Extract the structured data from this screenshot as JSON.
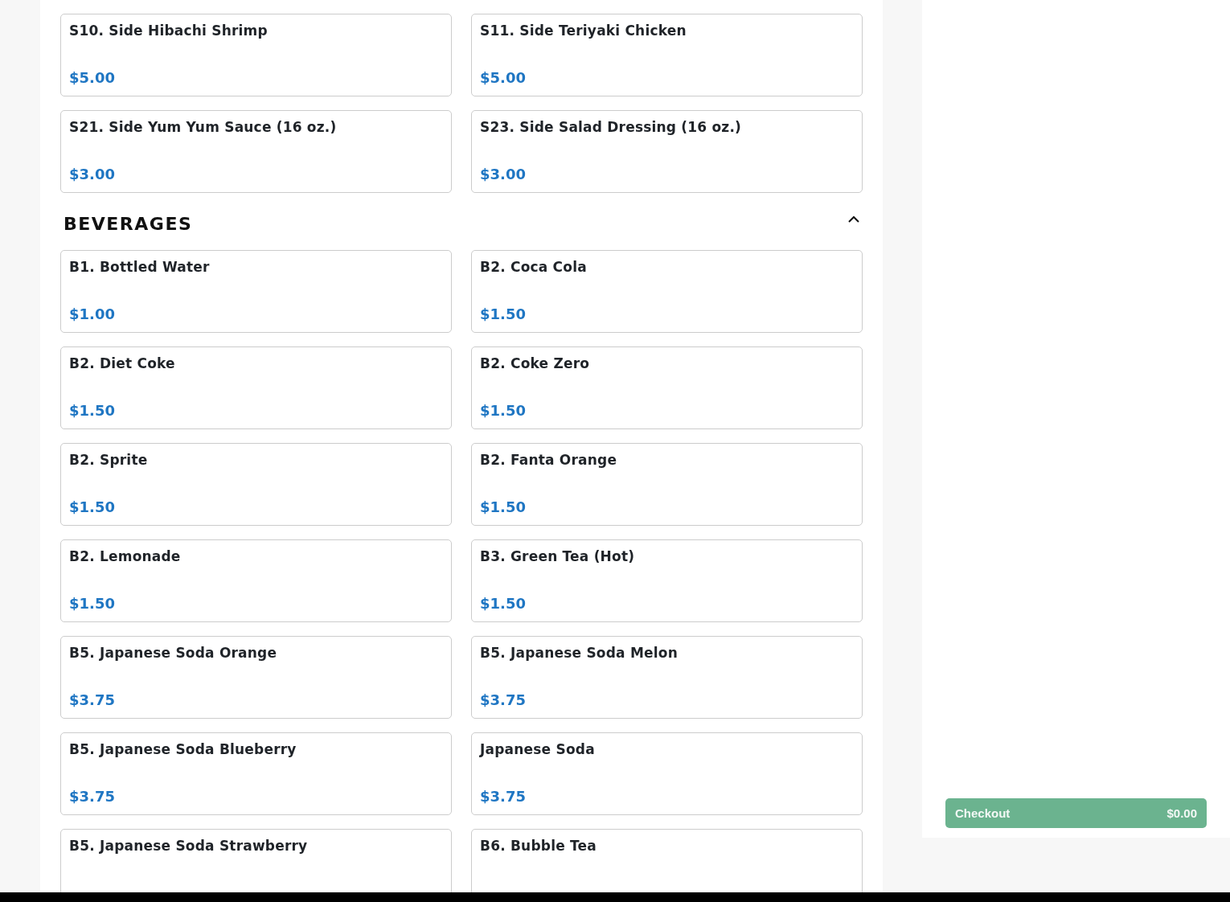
{
  "sections": [
    {
      "items": [
        {
          "name": "S10. Side Hibachi Shrimp",
          "price": "$5.00"
        },
        {
          "name": "S11. Side Teriyaki Chicken",
          "price": "$5.00"
        },
        {
          "name": "S21. Side Yum Yum Sauce (16 oz.)",
          "price": "$3.00"
        },
        {
          "name": "S23. Side Salad Dressing (16 oz.)",
          "price": "$3.00"
        }
      ]
    },
    {
      "title": "BEVERAGES",
      "expanded": true,
      "items": [
        {
          "name": "B1. Bottled Water",
          "price": "$1.00"
        },
        {
          "name": "B2. Coca Cola",
          "price": "$1.50"
        },
        {
          "name": "B2. Diet Coke",
          "price": "$1.50"
        },
        {
          "name": "B2. Coke Zero",
          "price": "$1.50"
        },
        {
          "name": "B2. Sprite",
          "price": "$1.50"
        },
        {
          "name": "B2. Fanta Orange",
          "price": "$1.50"
        },
        {
          "name": "B2. Lemonade",
          "price": "$1.50"
        },
        {
          "name": "B3. Green Tea (Hot)",
          "price": "$1.50"
        },
        {
          "name": "B5. Japanese Soda Orange",
          "price": "$3.75"
        },
        {
          "name": "B5. Japanese Soda Melon",
          "price": "$3.75"
        },
        {
          "name": "B5. Japanese Soda Blueberry",
          "price": "$3.75"
        },
        {
          "name": "Japanese Soda",
          "price": "$3.75"
        },
        {
          "name": "B5. Japanese Soda Strawberry"
        },
        {
          "name": "B6. Bubble Tea"
        }
      ]
    }
  ],
  "checkout": {
    "label": "Checkout",
    "total": "$0.00",
    "disabled": true
  }
}
